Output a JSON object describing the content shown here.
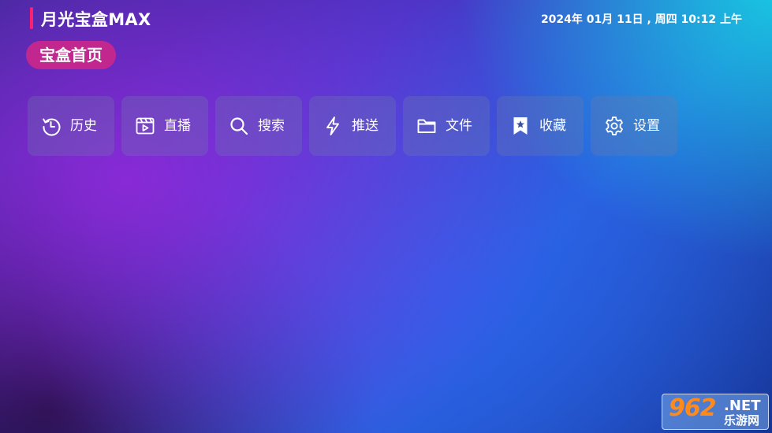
{
  "header": {
    "app_title": "月光宝盒MAX",
    "datetime": "2024年 01月 11日 , 周四 10:12 上午"
  },
  "home_chip": {
    "label": "宝盒首页"
  },
  "tiles": [
    {
      "label": "历史",
      "icon": "history-icon"
    },
    {
      "label": "直播",
      "icon": "live-video-icon"
    },
    {
      "label": "搜索",
      "icon": "search-icon"
    },
    {
      "label": "推送",
      "icon": "lightning-icon"
    },
    {
      "label": "文件",
      "icon": "folder-icon"
    },
    {
      "label": "收藏",
      "icon": "bookmark-star-icon"
    },
    {
      "label": "设置",
      "icon": "gear-icon"
    }
  ],
  "watermark": {
    "number": "962",
    "suffix": ".NET",
    "cn": "乐游网"
  },
  "colors": {
    "accent_pink": "#ff1f71",
    "chip_magenta": "#c2278f",
    "watermark_orange": "#ff8a1c"
  }
}
